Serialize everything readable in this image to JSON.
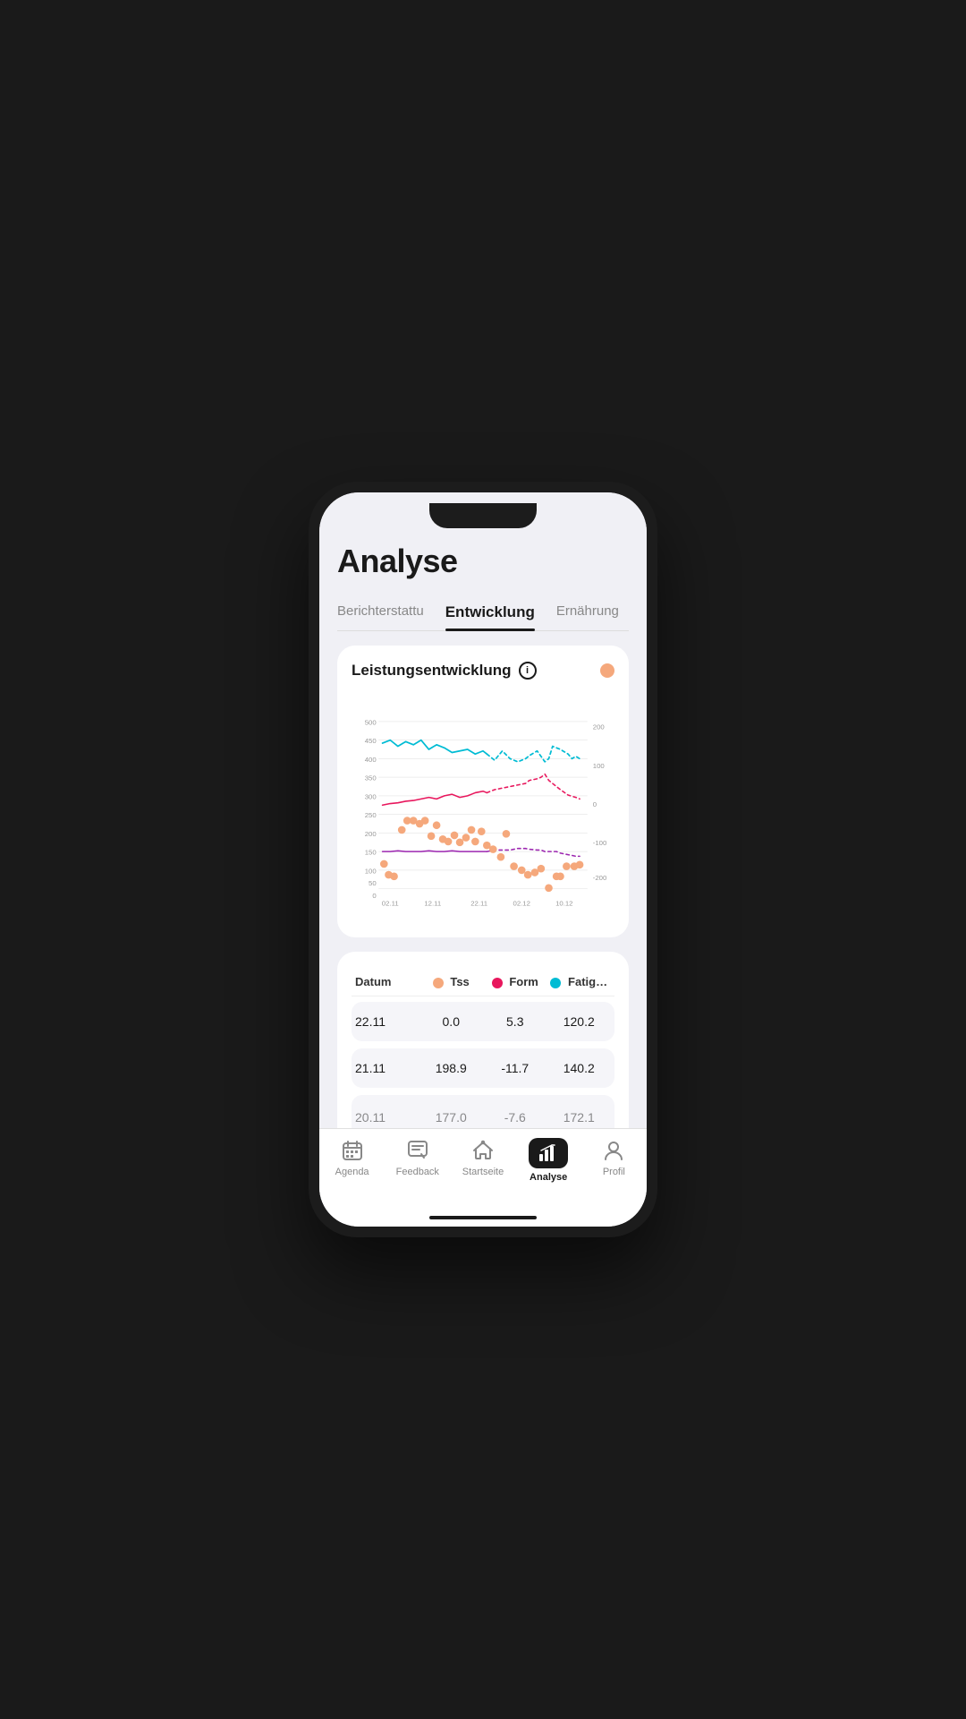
{
  "page": {
    "title": "Analyse",
    "background": "#f0f0f5"
  },
  "tabs": [
    {
      "id": "berichterstattung",
      "label": "Berichterstattu",
      "active": false
    },
    {
      "id": "entwicklung",
      "label": "Entwicklung",
      "active": true
    },
    {
      "id": "ernaehrung",
      "label": "Ernährung",
      "active": false
    }
  ],
  "chart": {
    "title": "Leistungsentwicklung",
    "info_icon": "i",
    "left_axis_labels": [
      "500",
      "450",
      "400",
      "350",
      "300",
      "250",
      "200",
      "150",
      "100",
      "50",
      "0"
    ],
    "right_axis_labels": [
      "200",
      "100",
      "0",
      "-100",
      "-200"
    ],
    "x_axis_labels": [
      "02.11",
      "12.11",
      "22.11",
      "02.12",
      "10.12"
    ]
  },
  "table": {
    "headers": [
      {
        "id": "datum",
        "label": "Datum"
      },
      {
        "id": "tss",
        "label": "Tss",
        "dot_color": "orange"
      },
      {
        "id": "form",
        "label": "Form",
        "dot_color": "pink"
      },
      {
        "id": "fatig",
        "label": "Fatig…",
        "dot_color": "blue"
      }
    ],
    "rows": [
      {
        "datum": "22.11",
        "tss": "0.0",
        "form": "5.3",
        "fatig": "120.2"
      },
      {
        "datum": "21.11",
        "tss": "198.9",
        "form": "-11.7",
        "fatig": "140.2"
      },
      {
        "datum": "20.11",
        "tss": "177.0",
        "form": "-7.6",
        "fatig": "172.1"
      }
    ]
  },
  "bottom_nav": [
    {
      "id": "agenda",
      "label": "Agenda",
      "active": false,
      "icon": "calendar"
    },
    {
      "id": "feedback",
      "label": "Feedback",
      "active": false,
      "icon": "edit-doc"
    },
    {
      "id": "startseite",
      "label": "Startseite",
      "active": false,
      "icon": "home"
    },
    {
      "id": "analyse",
      "label": "Analyse",
      "active": true,
      "icon": "chart"
    },
    {
      "id": "profil",
      "label": "Profil",
      "active": false,
      "icon": "person"
    }
  ]
}
